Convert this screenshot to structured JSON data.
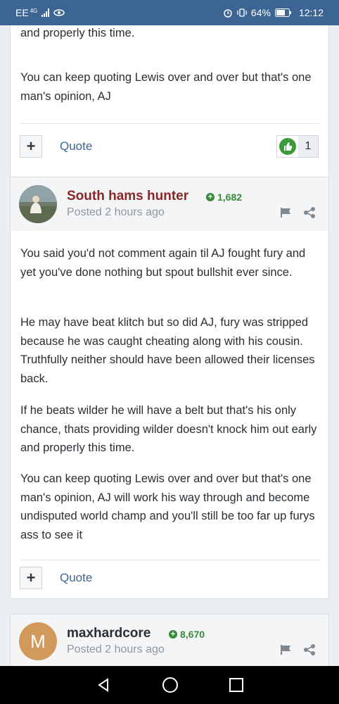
{
  "statusbar": {
    "carrier": "EE",
    "network": "4G",
    "battery": "64%",
    "time": "12:12"
  },
  "posts": [
    {
      "paragraphs": [
        "chance, thats providing wilder doesn't knock him out early and properly this time.",
        "You can keep quoting Lewis over and over but that's one man's opinion, AJ"
      ],
      "quote_label": "Quote",
      "reaction_count": "1"
    },
    {
      "author": "South hams hunter",
      "reputation": "1,682",
      "posted": "Posted 2 hours ago",
      "paragraphs": [
        "You said you'd not comment again til AJ fought fury and yet you've done nothing but spout bullshit ever since.",
        "He may have beat klitch but so did AJ, fury was stripped because he was caught cheating along with his cousin. Truthfully neither should have been allowed their licenses back.",
        "If he beats wilder he will have a belt but that's his only chance, thats providing wilder doesn't knock him out early and properly this time.",
        "You can keep quoting Lewis over and over but that's one man's opinion, AJ will work his way through and become undisputed world champ and you'll still be too far up furys ass to see it"
      ],
      "quote_label": "Quote"
    },
    {
      "author": "maxhardcore",
      "avatar_letter": "M",
      "reputation": "8,670",
      "posted": "Posted 2 hours ago"
    }
  ],
  "colors": {
    "statusbar": "#3d6594",
    "author_link": "#8a2828",
    "reputation": "#3a8a3a",
    "quote_link": "#3d6594",
    "reaction": "#3a9b3a",
    "avatar_m": "#d19a5a"
  },
  "icons": [
    "signal-icon",
    "eye-icon",
    "alarm-icon",
    "vibrate-icon",
    "battery-icon",
    "plus-icon",
    "like-icon",
    "flag-icon",
    "share-icon",
    "back-nav-icon",
    "home-nav-icon",
    "recents-nav-icon"
  ]
}
